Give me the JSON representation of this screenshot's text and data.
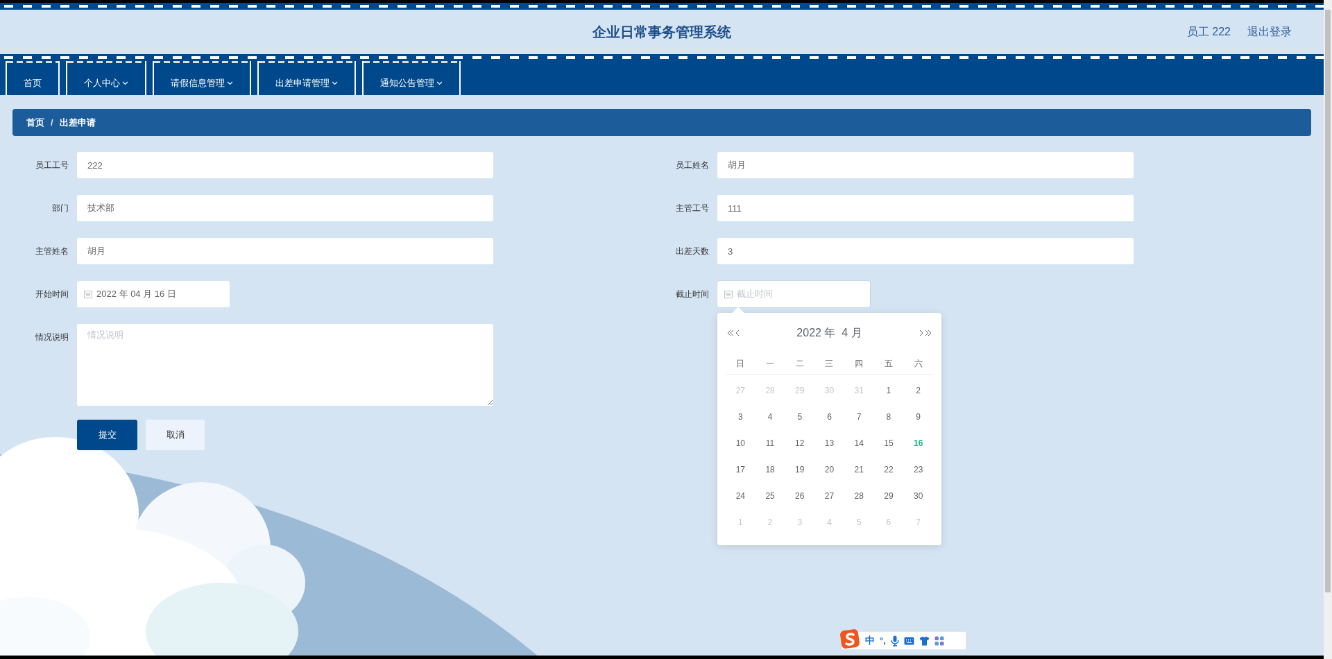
{
  "header": {
    "title": "企业日常事务管理系统",
    "user": "员工 222",
    "logout": "退出登录"
  },
  "nav": [
    {
      "label": "首页",
      "dropdown": false,
      "selected": false
    },
    {
      "label": "个人中心",
      "dropdown": true,
      "selected": false
    },
    {
      "label": "请假信息管理",
      "dropdown": true,
      "selected": false
    },
    {
      "label": "出差申请管理",
      "dropdown": true,
      "selected": false
    },
    {
      "label": "通知公告管理",
      "dropdown": true,
      "selected": false
    }
  ],
  "breadcrumb": {
    "items": [
      "首页",
      "出差申请"
    ],
    "separator": "/"
  },
  "form": {
    "rows": [
      [
        {
          "kind": "text",
          "label": "员工工号",
          "value": "222"
        },
        {
          "kind": "text",
          "label": "员工姓名",
          "value": "胡月"
        }
      ],
      [
        {
          "kind": "text",
          "label": "部门",
          "value": "技术部"
        },
        {
          "kind": "text",
          "label": "主管工号",
          "value": "111"
        }
      ],
      [
        {
          "kind": "text",
          "label": "主管姓名",
          "value": "胡月"
        },
        {
          "kind": "text",
          "label": "出差天数",
          "value": "3"
        }
      ],
      [
        {
          "kind": "date",
          "label": "开始时间",
          "value": "2022 年 04 月 16 日",
          "open": false
        },
        {
          "kind": "date",
          "label": "截止时间",
          "placeholder": "截止时间",
          "open": true
        }
      ],
      [
        {
          "kind": "textarea",
          "label": "情况说明",
          "placeholder": "情况说明"
        }
      ]
    ],
    "buttons": [
      {
        "label": "提交",
        "kind": "primary"
      },
      {
        "label": "取消",
        "kind": "secondary"
      }
    ]
  },
  "date_picker": {
    "title": "2022 年  4 月",
    "weekdays": [
      "日",
      "一",
      "二",
      "三",
      "四",
      "五",
      "六"
    ],
    "weeks": [
      [
        {
          "day": "27",
          "muted": true,
          "today": false
        },
        {
          "day": "28",
          "muted": true,
          "today": false
        },
        {
          "day": "29",
          "muted": true,
          "today": false
        },
        {
          "day": "30",
          "muted": true,
          "today": false
        },
        {
          "day": "31",
          "muted": true,
          "today": false
        },
        {
          "day": "1",
          "muted": false,
          "today": false
        },
        {
          "day": "2",
          "muted": false,
          "today": false
        }
      ],
      [
        {
          "day": "3",
          "muted": false,
          "today": false
        },
        {
          "day": "4",
          "muted": false,
          "today": false
        },
        {
          "day": "5",
          "muted": false,
          "today": false
        },
        {
          "day": "6",
          "muted": false,
          "today": false
        },
        {
          "day": "7",
          "muted": false,
          "today": false
        },
        {
          "day": "8",
          "muted": false,
          "today": false
        },
        {
          "day": "9",
          "muted": false,
          "today": false
        }
      ],
      [
        {
          "day": "10",
          "muted": false,
          "today": false
        },
        {
          "day": "11",
          "muted": false,
          "today": false
        },
        {
          "day": "12",
          "muted": false,
          "today": false
        },
        {
          "day": "13",
          "muted": false,
          "today": false
        },
        {
          "day": "14",
          "muted": false,
          "today": false
        },
        {
          "day": "15",
          "muted": false,
          "today": false
        },
        {
          "day": "16",
          "muted": false,
          "today": true
        }
      ],
      [
        {
          "day": "17",
          "muted": false,
          "today": false
        },
        {
          "day": "18",
          "muted": false,
          "today": false
        },
        {
          "day": "19",
          "muted": false,
          "today": false
        },
        {
          "day": "20",
          "muted": false,
          "today": false
        },
        {
          "day": "21",
          "muted": false,
          "today": false
        },
        {
          "day": "22",
          "muted": false,
          "today": false
        },
        {
          "day": "23",
          "muted": false,
          "today": false
        }
      ],
      [
        {
          "day": "24",
          "muted": false,
          "today": false
        },
        {
          "day": "25",
          "muted": false,
          "today": false
        },
        {
          "day": "26",
          "muted": false,
          "today": false
        },
        {
          "day": "27",
          "muted": false,
          "today": false
        },
        {
          "day": "28",
          "muted": false,
          "today": false
        },
        {
          "day": "29",
          "muted": false,
          "today": false
        },
        {
          "day": "30",
          "muted": false,
          "today": false
        }
      ],
      [
        {
          "day": "1",
          "muted": true,
          "today": false
        },
        {
          "day": "2",
          "muted": true,
          "today": false
        },
        {
          "day": "3",
          "muted": true,
          "today": false
        },
        {
          "day": "4",
          "muted": true,
          "today": false
        },
        {
          "day": "5",
          "muted": true,
          "today": false
        },
        {
          "day": "6",
          "muted": true,
          "today": false
        },
        {
          "day": "7",
          "muted": true,
          "today": false
        }
      ]
    ]
  },
  "ime_toolbar": {
    "label": "中",
    "punctuation": "°,"
  }
}
